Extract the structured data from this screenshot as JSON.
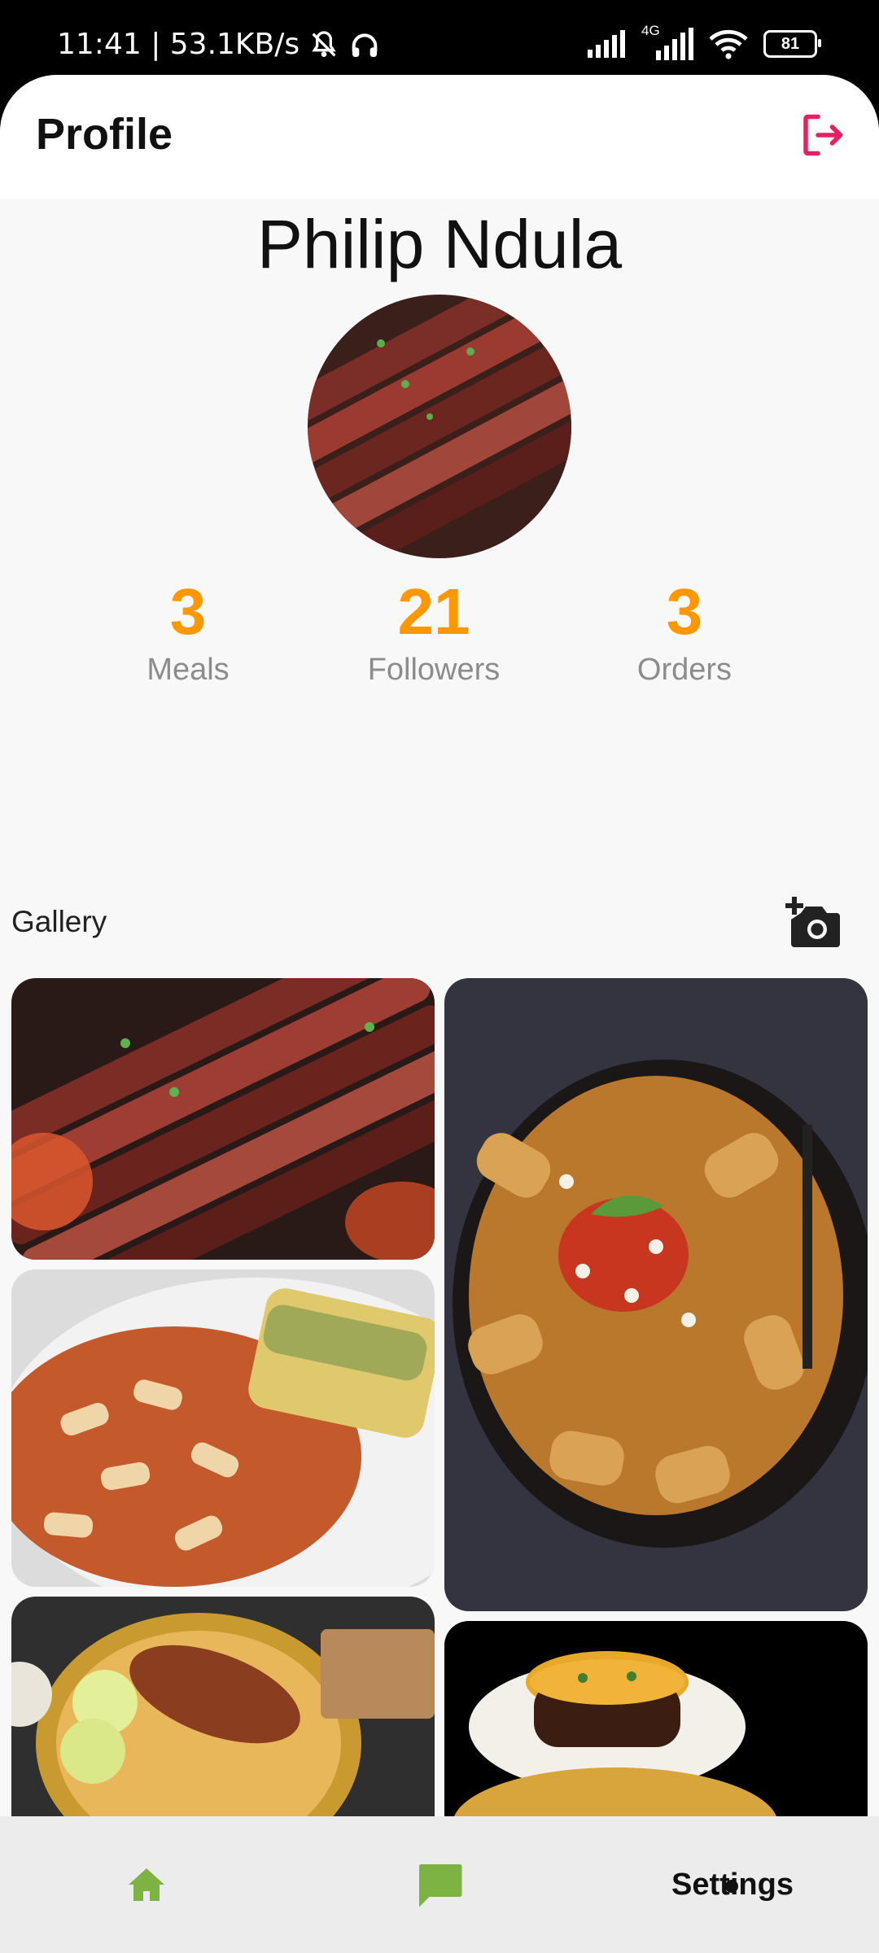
{
  "status_bar": {
    "time_speed": "11:41 | 53.1KB/s",
    "network": "4G",
    "battery": "81"
  },
  "appbar": {
    "title": "Profile"
  },
  "profile": {
    "name": "Philip Ndula",
    "stats": [
      {
        "value": "3",
        "label": "Meals"
      },
      {
        "value": "21",
        "label": "Followers"
      },
      {
        "value": "3",
        "label": "Orders"
      }
    ]
  },
  "gallery": {
    "label": "Gallery"
  },
  "bottom_nav": {
    "settings_label": "Settings"
  },
  "colors": {
    "accent": "#ff9800",
    "logout": "#e91e63",
    "nav_icon": "#7cb342"
  },
  "icons": [
    "mute-icon",
    "headphones-icon",
    "signal-icon",
    "wifi-icon",
    "battery-icon",
    "logout-icon",
    "add-photo-icon",
    "home-icon",
    "chat-icon"
  ]
}
